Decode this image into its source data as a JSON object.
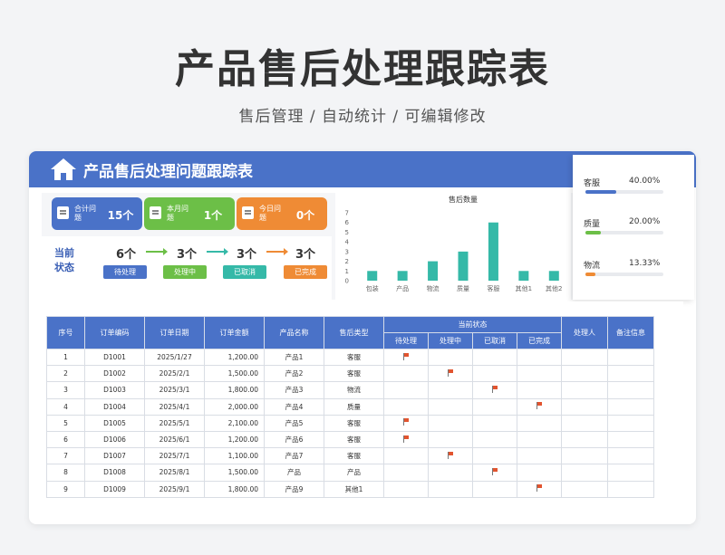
{
  "header": {
    "title": "产品售后处理跟踪表",
    "subtitle": "售后管理 /  自动统计  /  可编辑修改"
  },
  "card": {
    "title": "产品售后处理问题跟踪表"
  },
  "tiles": [
    {
      "label": "合计问题",
      "value": "15个",
      "color": "#4a72c8"
    },
    {
      "label": "本月问题",
      "value": "1个",
      "color": "#6cbf47"
    },
    {
      "label": "今日问题",
      "value": "0个",
      "color": "#ef8b35"
    }
  ],
  "status": {
    "title": "当前状态",
    "items": [
      {
        "label": "待处理",
        "count": "6个",
        "color": "#4a72c8"
      },
      {
        "label": "处理中",
        "count": "3个",
        "color": "#6cbf47"
      },
      {
        "label": "已取消",
        "count": "3个",
        "color": "#35b9a8"
      },
      {
        "label": "已完成",
        "count": "3个",
        "color": "#ef8b35"
      }
    ]
  },
  "stats": [
    {
      "name": "客服",
      "pct": "40.00%",
      "fraction": 0.4,
      "color": "#4a72c8"
    },
    {
      "name": "质量",
      "pct": "20.00%",
      "fraction": 0.2,
      "color": "#6cbf47"
    },
    {
      "name": "物流",
      "pct": "13.33%",
      "fraction": 0.1333,
      "color": "#ef8b35"
    }
  ],
  "chart_data": {
    "type": "bar",
    "title": "售后数量",
    "categories": [
      "包装",
      "产品",
      "物流",
      "质量",
      "客服",
      "其他1",
      "其他2"
    ],
    "values": [
      1,
      1,
      2,
      3,
      6,
      1,
      1
    ],
    "ylim": [
      0,
      7
    ],
    "yticks": [
      "0",
      "1",
      "2",
      "3",
      "4",
      "5",
      "6",
      "7"
    ],
    "color": "#35b9a8",
    "grid": false
  },
  "table": {
    "headers": {
      "seq": "序号",
      "order": "订单编码",
      "date": "订单日期",
      "amount": "订单金额",
      "product": "产品名称",
      "type": "售后类型",
      "status": "当前状态",
      "handler": "处理人",
      "note": "备注信息"
    },
    "status_cols": [
      "待处理",
      "处理中",
      "已取消",
      "已完成"
    ],
    "rows": [
      {
        "seq": "1",
        "order": "D1001",
        "date": "2025/1/27",
        "amount": "1,200.00",
        "product": "产品1",
        "type": "客服",
        "status": 0
      },
      {
        "seq": "2",
        "order": "D1002",
        "date": "2025/2/1",
        "amount": "1,500.00",
        "product": "产品2",
        "type": "客服",
        "status": 1
      },
      {
        "seq": "3",
        "order": "D1003",
        "date": "2025/3/1",
        "amount": "1,800.00",
        "product": "产品3",
        "type": "物流",
        "status": 2
      },
      {
        "seq": "4",
        "order": "D1004",
        "date": "2025/4/1",
        "amount": "2,000.00",
        "product": "产品4",
        "type": "质量",
        "status": 3
      },
      {
        "seq": "5",
        "order": "D1005",
        "date": "2025/5/1",
        "amount": "2,100.00",
        "product": "产品5",
        "type": "客服",
        "status": 0
      },
      {
        "seq": "6",
        "order": "D1006",
        "date": "2025/6/1",
        "amount": "1,200.00",
        "product": "产品6",
        "type": "客服",
        "status": 0
      },
      {
        "seq": "7",
        "order": "D1007",
        "date": "2025/7/1",
        "amount": "1,100.00",
        "product": "产品7",
        "type": "客服",
        "status": 1
      },
      {
        "seq": "8",
        "order": "D1008",
        "date": "2025/8/1",
        "amount": "1,500.00",
        "product": "产品",
        "type": "产品",
        "status": 2
      },
      {
        "seq": "9",
        "order": "D1009",
        "date": "2025/9/1",
        "amount": "1,800.00",
        "product": "产品9",
        "type": "其他1",
        "status": 3
      }
    ]
  }
}
